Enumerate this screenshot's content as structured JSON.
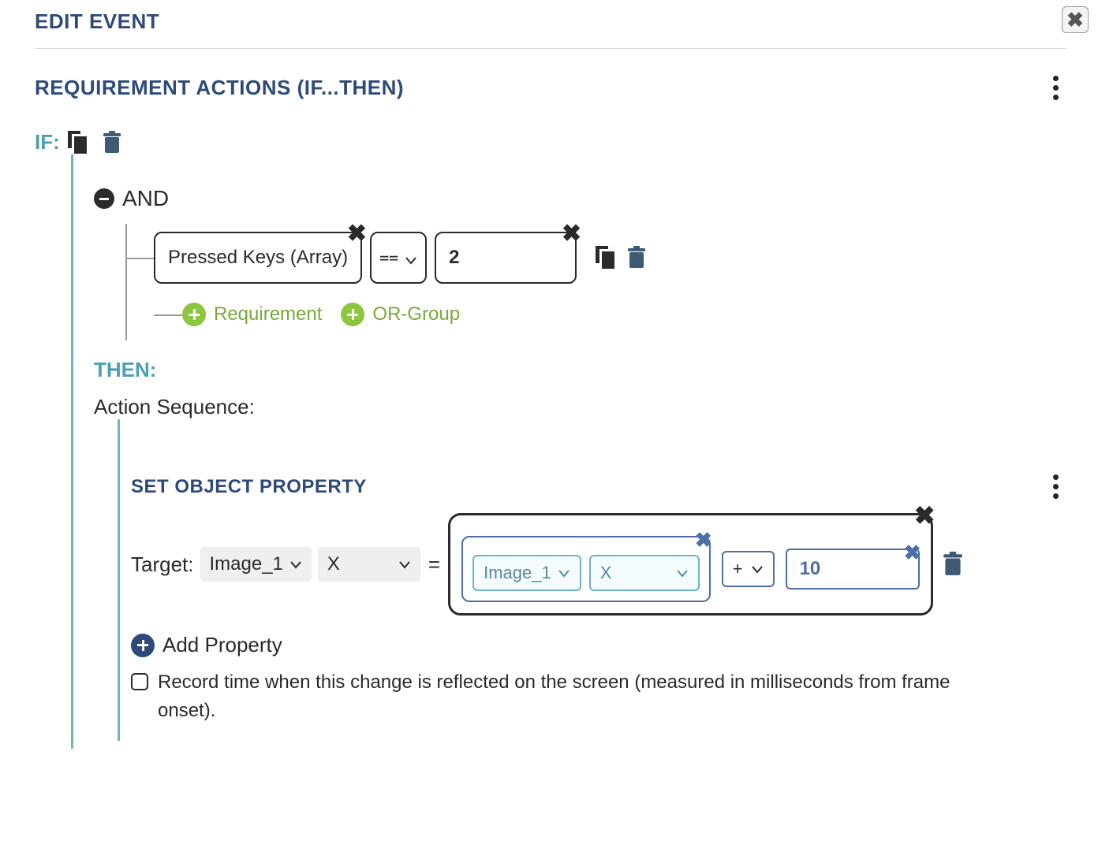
{
  "title": "EDIT EVENT",
  "section_title": "REQUIREMENT ACTIONS (IF...THEN)",
  "if_label": "IF:",
  "and_label": "AND",
  "condition": {
    "left": "Pressed Keys (Array)",
    "operator": "==",
    "right": "2"
  },
  "add_requirement_label": "Requirement",
  "add_orgroup_label": "OR-Group",
  "then_label": "THEN:",
  "action_sequence_label": "Action Sequence:",
  "sop": {
    "title": "SET OBJECT PROPERTY",
    "target_label": "Target:",
    "target_object": "Image_1",
    "target_property": "X",
    "equals": "=",
    "ref_object": "Image_1",
    "ref_property": "X",
    "operator": "+",
    "value": "10",
    "add_property_label": "Add Property",
    "record_label": "Record time when this change is reflected on the screen (measured in milliseconds from frame onset).",
    "record_checked": false
  }
}
